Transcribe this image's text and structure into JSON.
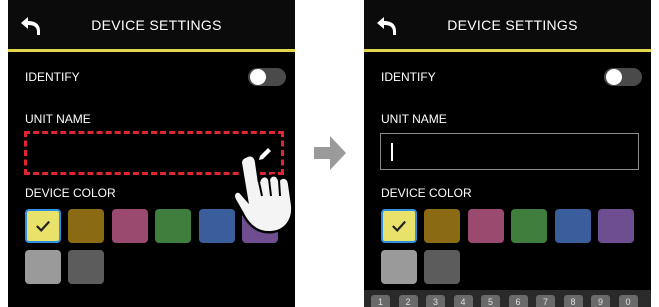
{
  "screen_before": {
    "header": {
      "title": "DEVICE SETTINGS",
      "back_icon": "back-arrow-icon"
    },
    "identify": {
      "label": "IDENTIFY",
      "toggle_state": "off"
    },
    "unit_name": {
      "label": "UNIT NAME",
      "value": "",
      "edit_icon": "pencil-icon",
      "highlighted": true
    },
    "device_color": {
      "label": "DEVICE COLOR",
      "swatches": [
        "#e9e26a",
        "#8a6a12",
        "#9a4a6e",
        "#3f7e3c",
        "#3a5e9c",
        "#6e4e90",
        "#9a9a9a",
        "#5c5c5c"
      ],
      "selected_index": 0
    }
  },
  "screen_after": {
    "header": {
      "title": "DEVICE SETTINGS",
      "back_icon": "back-arrow-icon"
    },
    "identify": {
      "label": "IDENTIFY",
      "toggle_state": "off"
    },
    "unit_name": {
      "label": "UNIT NAME",
      "value": "",
      "cursor_visible": true
    },
    "device_color": {
      "label": "DEVICE COLOR",
      "swatches": [
        "#e9e26a",
        "#8a6a12",
        "#9a4a6e",
        "#3f7e3c",
        "#3a5e9c",
        "#6e4e90",
        "#9a9a9a",
        "#5c5c5c"
      ],
      "selected_index": 0
    },
    "keyboard": {
      "keys": [
        "1",
        "2",
        "3",
        "4",
        "5",
        "6",
        "7",
        "8",
        "9",
        "0"
      ]
    }
  },
  "transition_icon": "right-arrow-icon",
  "gesture_icon": "tap-hand-icon",
  "colors": {
    "accent_yellow": "#e4d64a",
    "highlight_red": "#e0262e",
    "selection_blue": "#2f8fe0"
  }
}
